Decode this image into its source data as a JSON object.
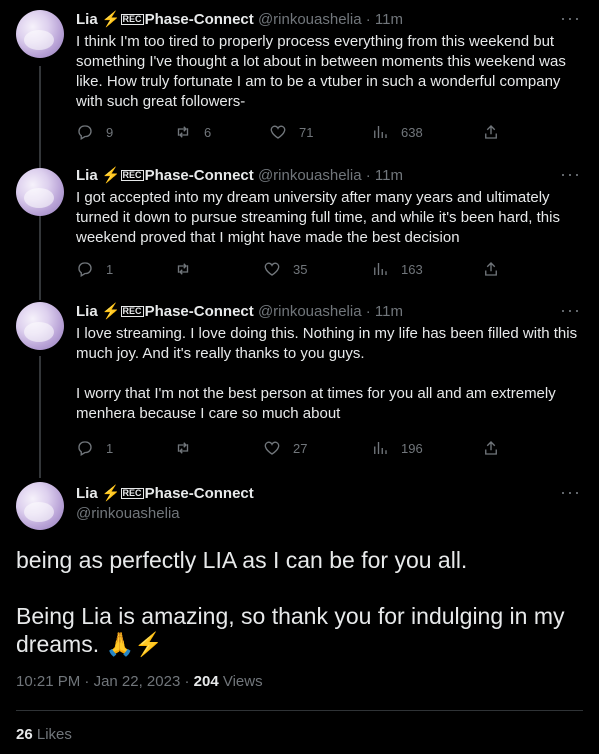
{
  "author": {
    "display_name": "Lia",
    "bolt": "⚡",
    "badge": "REC",
    "org": "Phase-Connect",
    "handle": "@rinkouashelia"
  },
  "replies": [
    {
      "time": "11m",
      "text": "I think I'm too tired to properly process everything from this weekend but something I've thought a lot about in between moments this weekend was like. How truly fortunate I am to be a vtuber in such a wonderful company with such great followers-",
      "reply_count": "9",
      "retweet_count": "6",
      "like_count": "71",
      "view_count": "638"
    },
    {
      "time": "11m",
      "text": "I got accepted into my dream university after many years and ultimately turned it down to pursue streaming full time, and while it's been hard, this weekend proved that I might have made the best decision",
      "reply_count": "1",
      "retweet_count": "",
      "like_count": "35",
      "view_count": "163"
    },
    {
      "time": "11m",
      "text": "I love streaming. I love doing this. Nothing in my life has been filled with this much joy. And it's really thanks to you guys.\n\nI worry that I'm not the best person at times for you all and am extremely menhera because I care so much about",
      "reply_count": "1",
      "retweet_count": "",
      "like_count": "27",
      "view_count": "196"
    }
  ],
  "main_tweet": {
    "text": "being as perfectly LIA as I can be for you all.\n\nBeing Lia is amazing, so thank you for indulging in my dreams. 🙏⚡",
    "time": "10:21 PM",
    "date": "Jan 22, 2023",
    "views_count": "204",
    "views_label": "Views",
    "likes_count": "26",
    "likes_label": "Likes"
  },
  "icons": [
    "more-icon",
    "reply-icon",
    "retweet-icon",
    "like-icon",
    "views-icon",
    "share-icon"
  ]
}
